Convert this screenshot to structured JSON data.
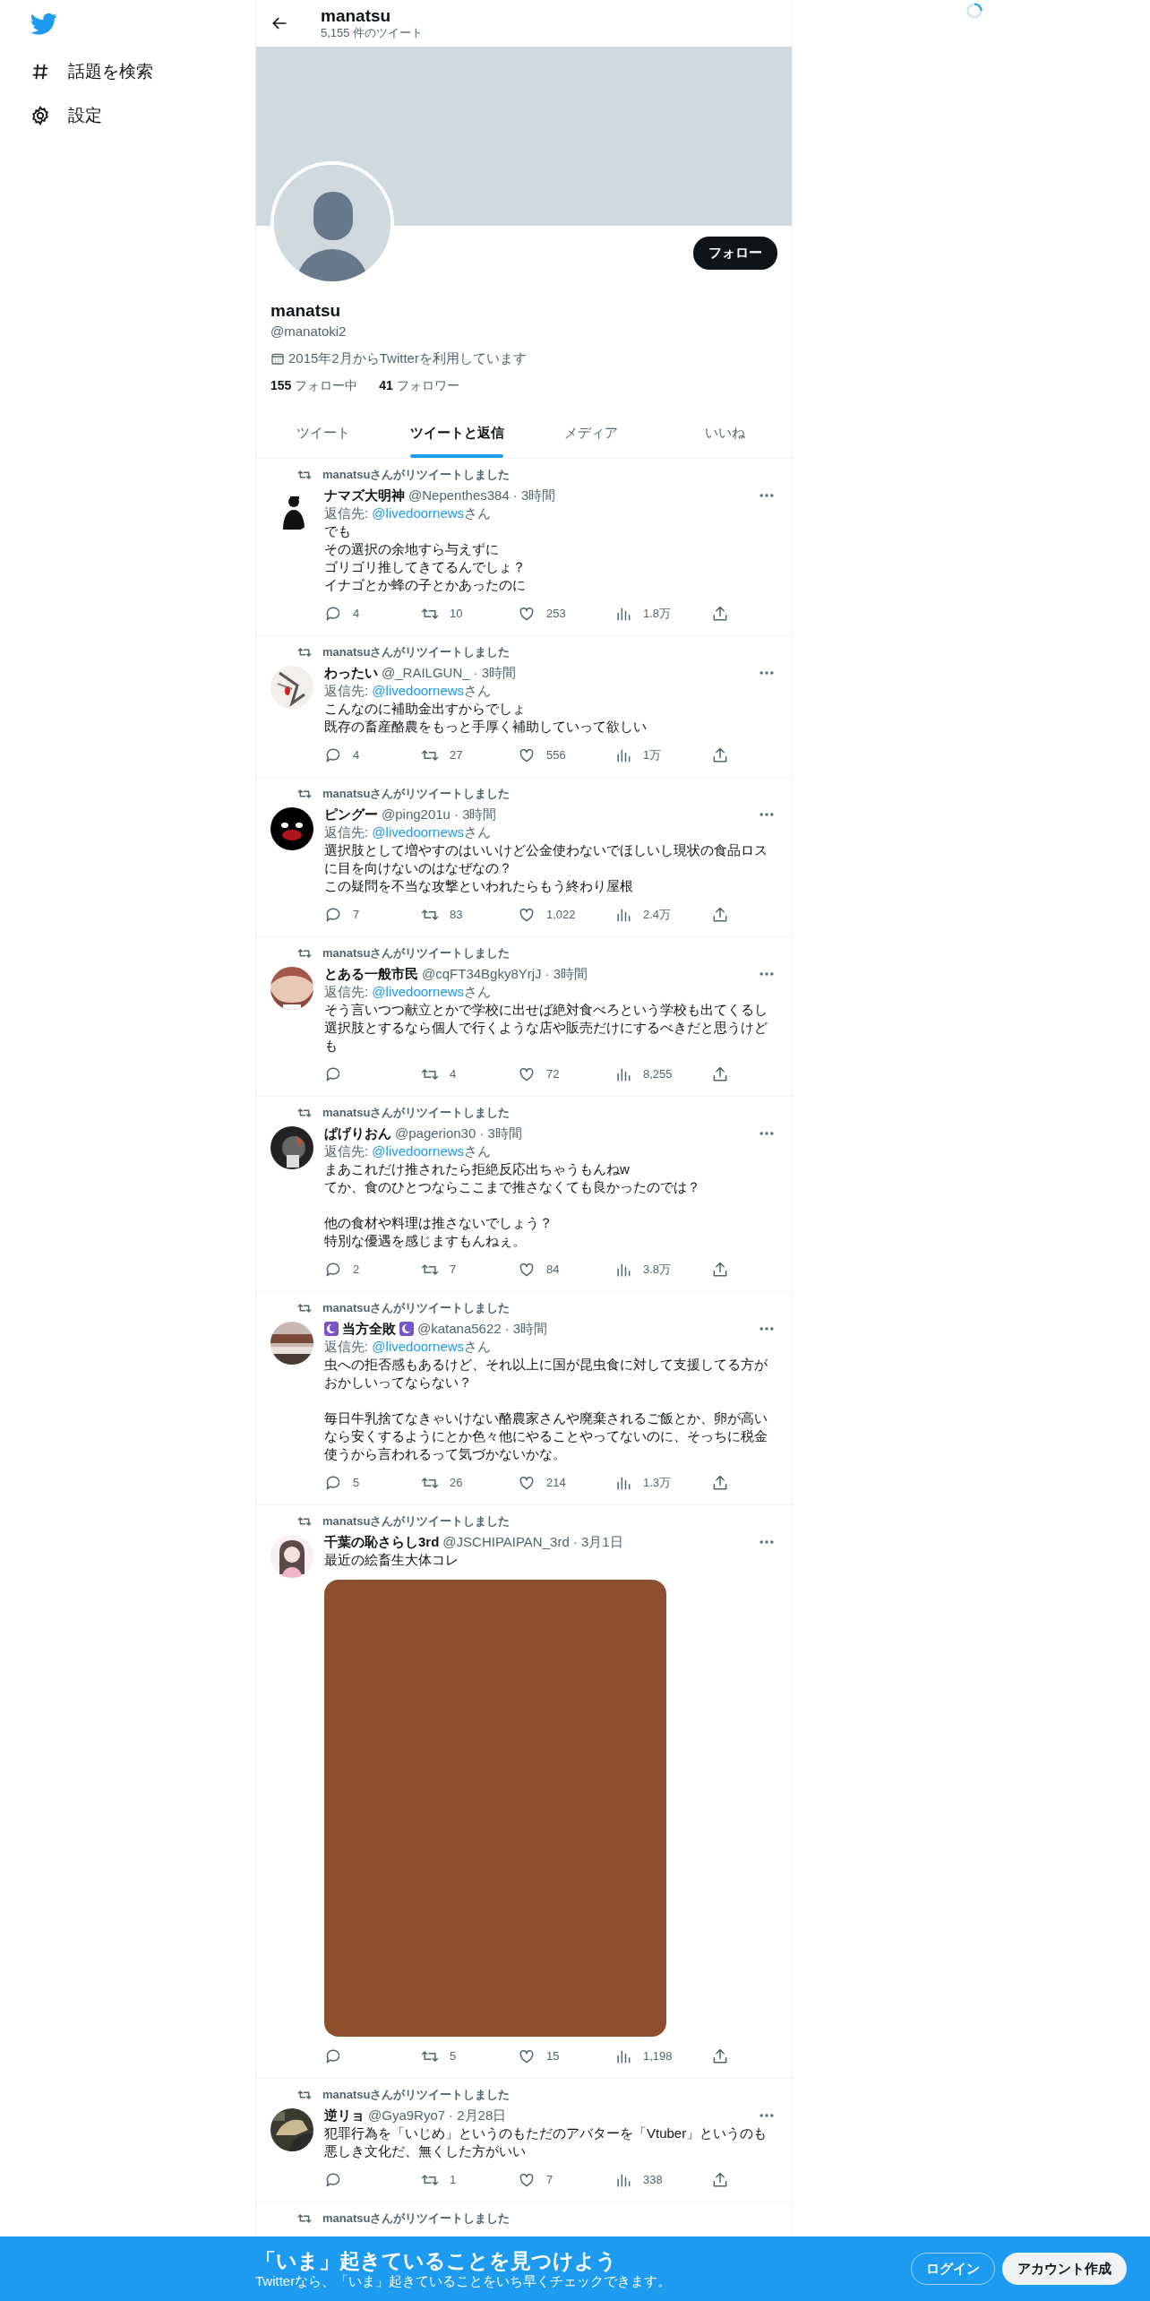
{
  "sidebar": {
    "items": [
      {
        "kind": "explore",
        "label": "話題を検索"
      },
      {
        "kind": "settings",
        "label": "設定"
      }
    ]
  },
  "header": {
    "title": "manatsu",
    "subtitle": "5,155 件のツイート"
  },
  "profile": {
    "name": "manatsu",
    "handle": "@manatoki2",
    "joined": "2015年2月からTwitterを利用しています",
    "following_count": "155",
    "following_label": "フォロー中",
    "followers_count": "41",
    "followers_label": "フォロワー",
    "follow_button": "フォロー"
  },
  "tabs": [
    {
      "label": "ツイート",
      "selected": false
    },
    {
      "label": "ツイートと返信",
      "selected": true
    },
    {
      "label": "メディア",
      "selected": false
    },
    {
      "label": "いいね",
      "selected": false
    }
  ],
  "tweets": [
    {
      "retweeted_by": "manatsuさんがリツイートしました",
      "name": "ナマズ大明神",
      "handle": "@Nepenthes384",
      "time": "· 3時間",
      "reply_to": {
        "prefix": "返信先: ",
        "handle": "@livedoornews",
        "suffix": "さん"
      },
      "text": [
        [
          "でも",
          "その選択の余地すら与えずに",
          "ゴリゴリ推してきてるんでしょ？",
          "イナゴとか蜂の子とかあったのに"
        ]
      ],
      "replies": "4",
      "retweets": "10",
      "likes": "253",
      "views": "1.8万"
    },
    {
      "retweeted_by": "manatsuさんがリツイートしました",
      "name": "わったい",
      "handle": "@_RAILGUN_",
      "time": "· 3時間",
      "reply_to": {
        "prefix": "返信先: ",
        "handle": "@livedoornews",
        "suffix": "さん"
      },
      "text": [
        [
          "こんなのに補助金出すからでしょ",
          "既存の畜産酪農をもっと手厚く補助していって欲しい"
        ]
      ],
      "replies": "4",
      "retweets": "27",
      "likes": "556",
      "views": "1万"
    },
    {
      "retweeted_by": "manatsuさんがリツイートしました",
      "name": "ピングー",
      "handle": "@ping201u",
      "time": "· 3時間",
      "reply_to": {
        "prefix": "返信先: ",
        "handle": "@livedoornews",
        "suffix": "さん"
      },
      "text": [
        [
          "選択肢として増やすのはいいけど公金使わないでほしいし現状の食品ロスに目を向けないのはなぜなの？",
          "この疑問を不当な攻撃といわれたらもう終わり屋根"
        ]
      ],
      "replies": "7",
      "retweets": "83",
      "likes": "1,022",
      "views": "2.4万"
    },
    {
      "retweeted_by": "manatsuさんがリツイートしました",
      "name": "とある一般市民",
      "handle": "@cqFT34Bgky8YrjJ",
      "time": "· 3時間",
      "reply_to": {
        "prefix": "返信先: ",
        "handle": "@livedoornews",
        "suffix": "さん"
      },
      "text": [
        [
          "そう言いつつ献立とかで学校に出せば絶対食べろという学校も出てくるし選択肢とするなら個人で行くような店や販売だけにするべきだと思うけども"
        ]
      ],
      "retweets": "4",
      "likes": "72",
      "views": "8,255"
    },
    {
      "retweeted_by": "manatsuさんがリツイートしました",
      "name": "ぱげりおん",
      "handle": "@pagerion30",
      "time": "· 3時間",
      "reply_to": {
        "prefix": "返信先: ",
        "handle": "@livedoornews",
        "suffix": "さん"
      },
      "text": [
        [
          "まあこれだけ推されたら拒絶反応出ちゃうもんねw",
          "てか、食のひとつならここまで推さなくても良かったのでは？"
        ],
        [
          "他の食材や料理は推さないでしょう？",
          "特別な優遇を感じますもんねぇ。"
        ]
      ],
      "replies": "2",
      "retweets": "7",
      "likes": "84",
      "views": "3.8万"
    },
    {
      "retweeted_by": "manatsuさんがリツイートしました",
      "name": "当方全敗",
      "name_emoji": true,
      "handle": "@katana5622",
      "time": "· 3時間",
      "reply_to": {
        "prefix": "返信先: ",
        "handle": "@livedoornews",
        "suffix": "さん"
      },
      "text": [
        [
          "虫への拒否感もあるけど、それ以上に国が昆虫食に対して支援してる方がおかしいってならない？"
        ],
        [
          "毎日牛乳捨てなきゃいけない酪農家さんや廃棄されるご飯とか、卵が高いなら安くするようにとか色々他にやることやってないのに、そっちに税金使うから言われるって気づかないかな。"
        ]
      ],
      "replies": "5",
      "retweets": "26",
      "likes": "214",
      "views": "1.3万"
    },
    {
      "retweeted_by": "manatsuさんがリツイートしました",
      "name": "千葉の恥さらし3rd",
      "handle": "@JSCHIPAIPAN_3rd",
      "time": "· 3月1日",
      "text": [
        [
          "最近の絵畜生大体コレ"
        ]
      ],
      "has_media": true,
      "retweets": "5",
      "likes": "15",
      "views": "1,198"
    },
    {
      "retweeted_by": "manatsuさんがリツイートしました",
      "name": "逆リョ",
      "handle": "@Gya9Ryo7",
      "time": "· 2月28日",
      "text": [
        [
          "犯罪行為を「いじめ」というのもただのアバターを「Vtuber」というのも悪しき文化だ、無くした方がいい"
        ]
      ],
      "retweets": "1",
      "likes": "7",
      "views": "338"
    },
    {
      "retweeted_by": "manatsuさんがリツイートしました"
    }
  ],
  "banner": {
    "title": "「いま」起きていることを見つけよう",
    "subtitle": "Twitterなら、「いま」起きていることをいち早くチェックできます。",
    "login": "ログイン",
    "signup": "アカウント作成"
  }
}
